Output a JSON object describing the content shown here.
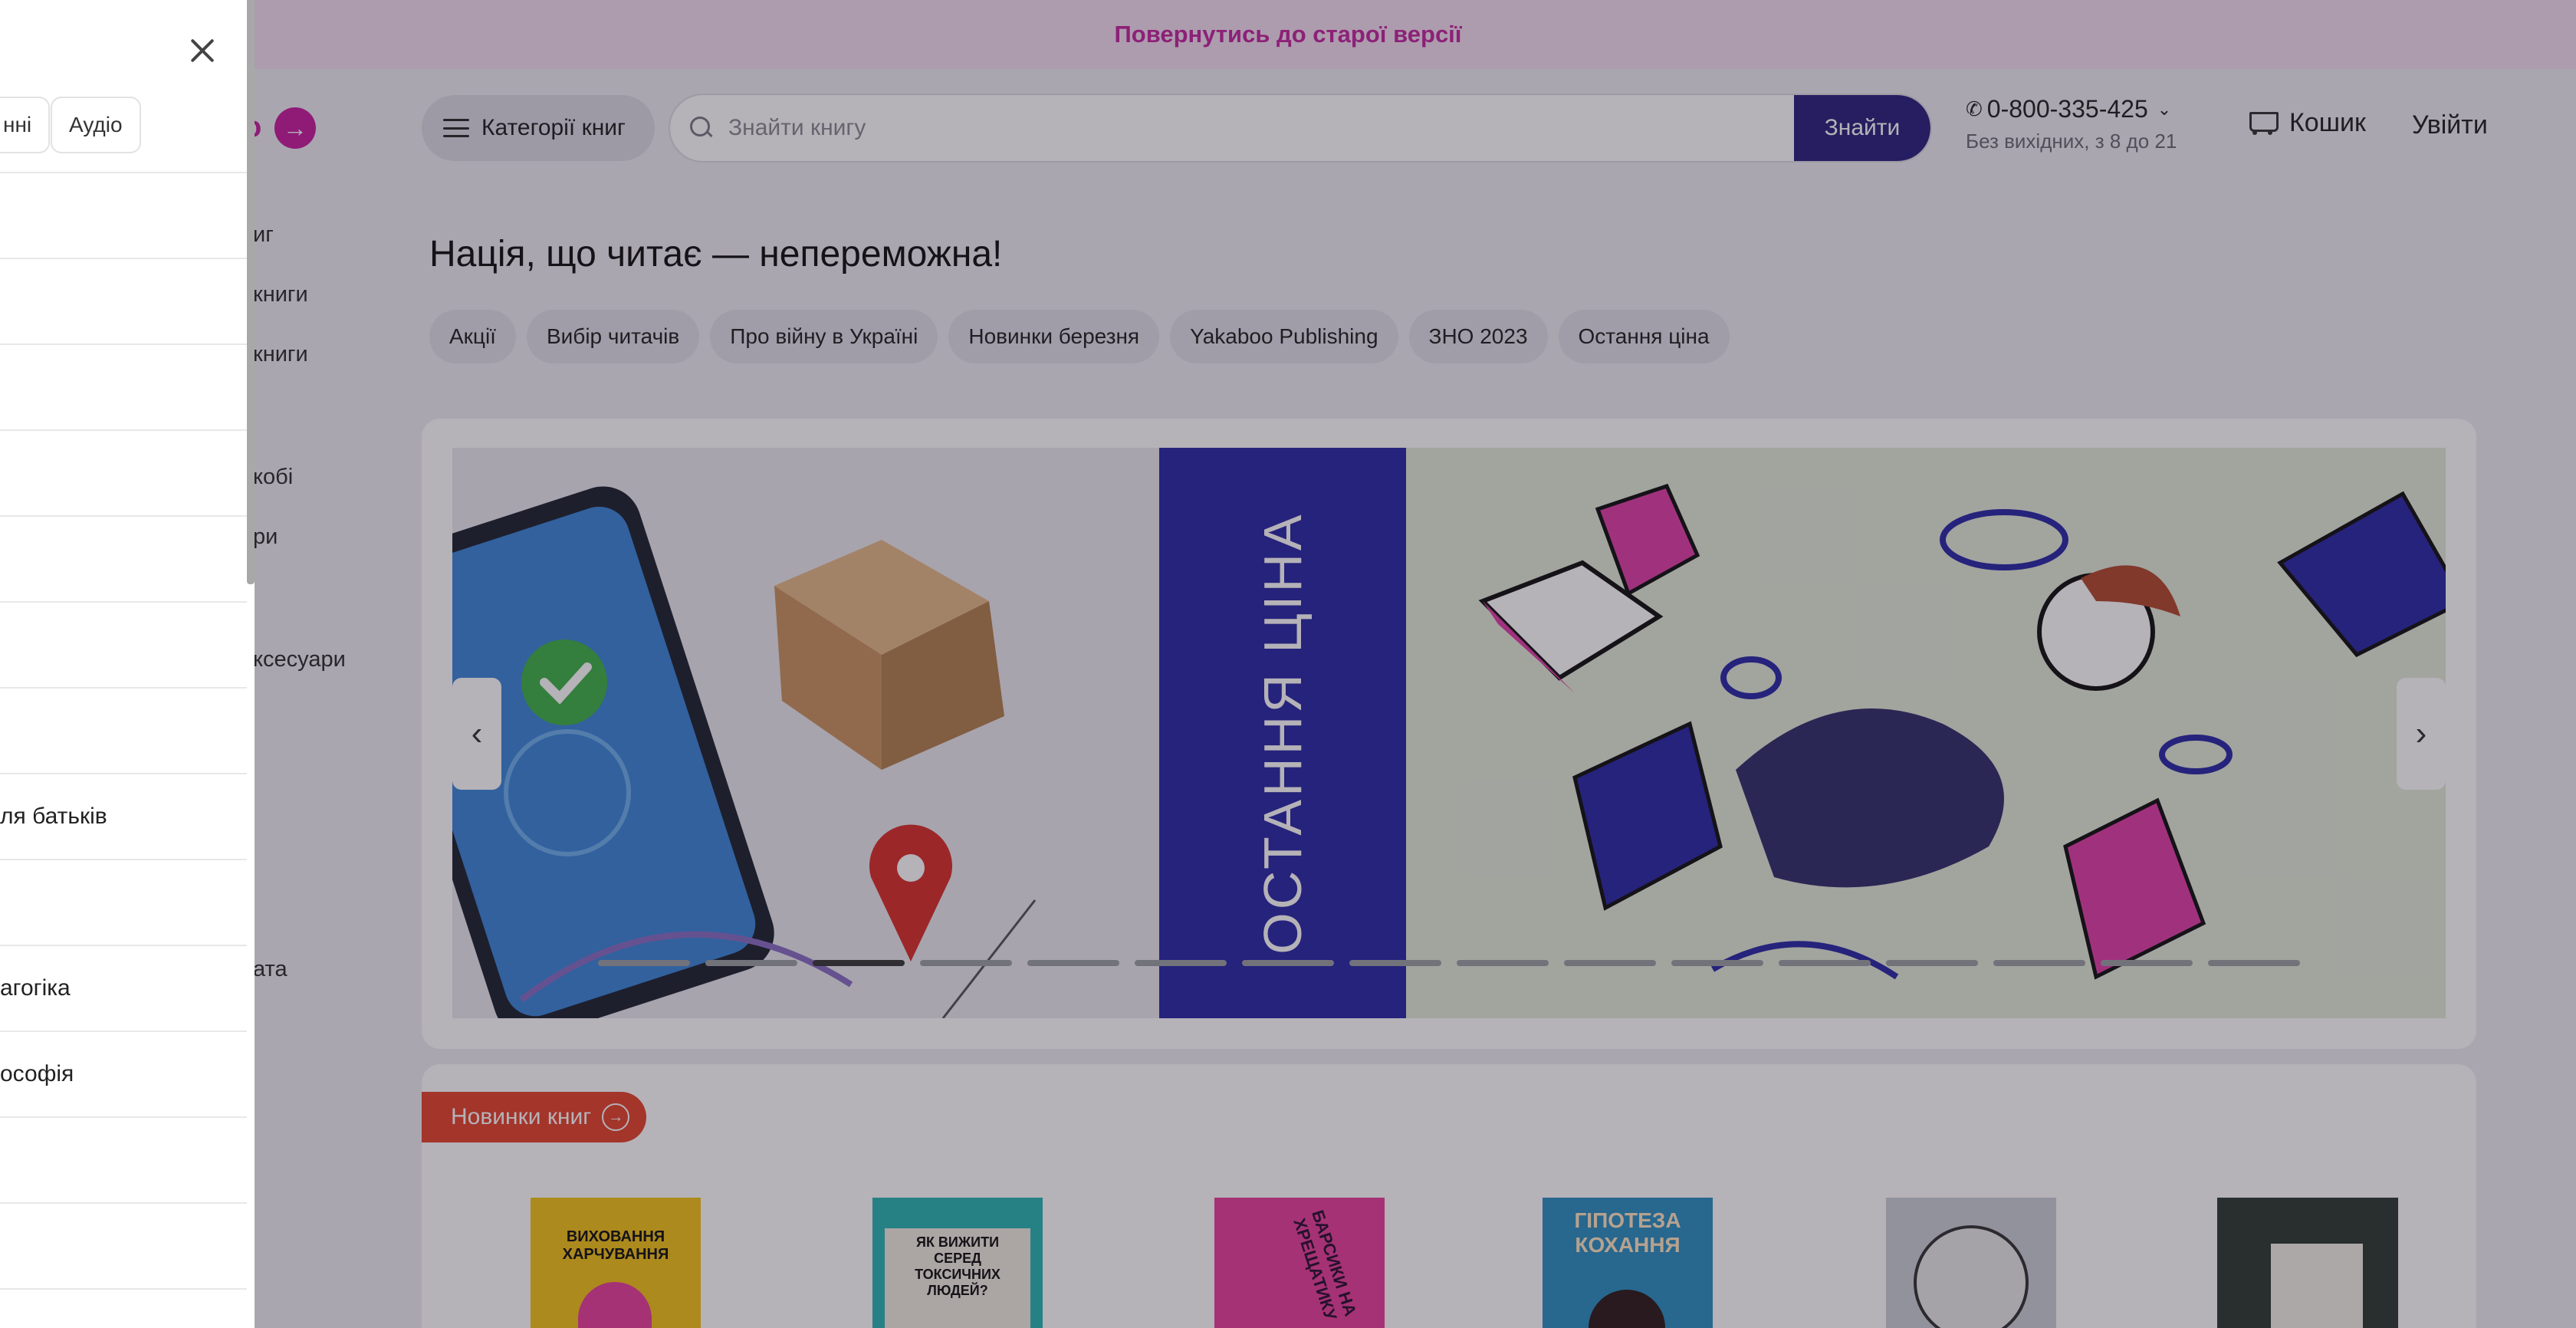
{
  "topbar": {
    "text": "Повернутись до старої версії"
  },
  "header": {
    "logo_text": "о",
    "logo_icon_text": "→",
    "categories_label": "Категорії книг",
    "search_placeholder": "Знайти книгу",
    "search_button": "Знайти",
    "phone": "0-800-335-425",
    "phone_hours": "Без вихідних, з 8 до 21",
    "cart_label": "Кошик",
    "login_label": "Увійти"
  },
  "side_categories": [
    "иг",
    "книги",
    "книги",
    "кобі",
    "ри",
    "ксесуари",
    "ата"
  ],
  "headline": "Нація, що читає — непереможна!",
  "chips": [
    "Акції",
    "Вибір читачів",
    "Про війну в Україні",
    "Новинки березня",
    "Yakaboo Publishing",
    "ЗНО 2023",
    "Остання ціна"
  ],
  "banner": {
    "vertical_text": "ОСТАННЯ ЦІНА",
    "dot_count": 16,
    "active_dot": 2,
    "prev_label": "‹",
    "next_label": "›"
  },
  "new_books": {
    "label": "Новинки книг",
    "label_icon": "→",
    "covers": [
      {
        "color": "#f2c419",
        "title": "ВИХОВАННЯ ХАРЧУВАННЯ"
      },
      {
        "color": "#2bb6b3",
        "title": "ЯК ВИЖИТИ СЕРЕД ТОКСИЧНИХ ЛЮДЕЙ?"
      },
      {
        "color": "#e8419a",
        "title": "БАРСИКИ НА ХРЕЩАТИКУ"
      },
      {
        "color": "#2e8fc0",
        "title": "ГІПОТЕЗА КОХАННЯ"
      },
      {
        "color": "#c9cfd6",
        "title": ""
      },
      {
        "color": "#2f3b33",
        "title": ""
      }
    ]
  },
  "drawer": {
    "tabs": [
      "нні",
      "Аудіо"
    ],
    "rows": [
      "",
      "",
      "",
      "",
      "",
      "",
      "",
      "ля батьків",
      "",
      "агогіка",
      "ософія",
      "",
      "",
      ""
    ]
  },
  "colors": {
    "accent": "#2a237d",
    "brand": "#c71f9e",
    "new_tag": "#e5452e",
    "banner_blue": "#2b2ba6"
  }
}
